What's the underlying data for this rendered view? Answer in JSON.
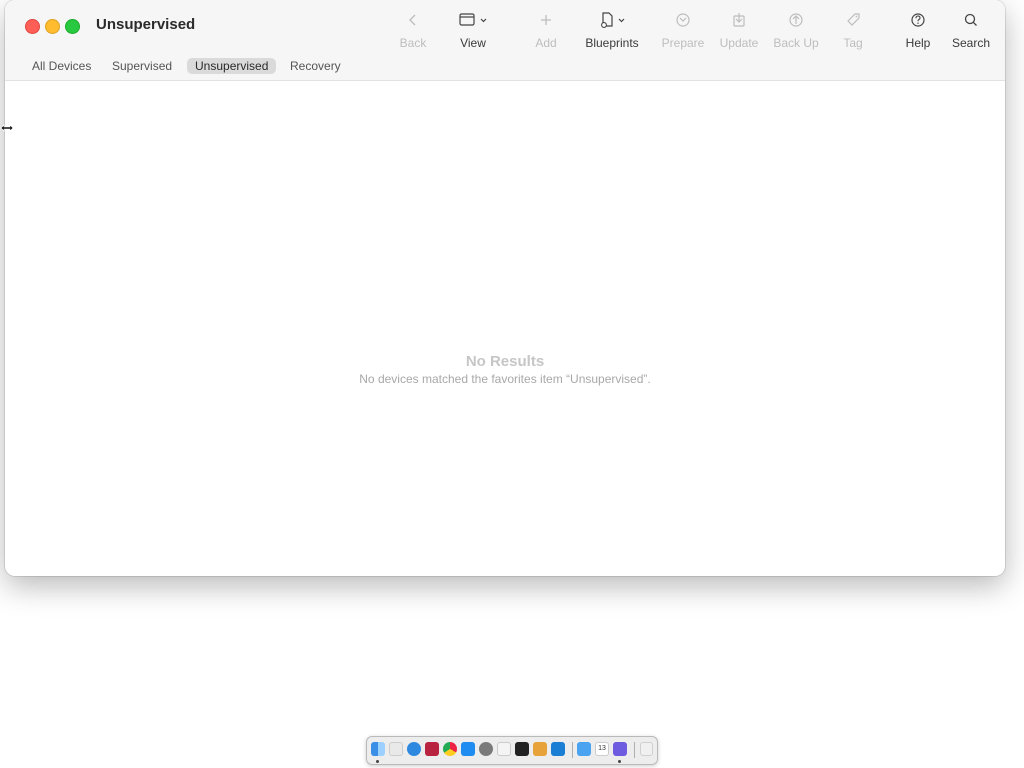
{
  "window": {
    "title": "Unsupervised"
  },
  "toolbar": {
    "back": "Back",
    "view": "View",
    "add": "Add",
    "blueprints": "Blueprints",
    "prepare": "Prepare",
    "update": "Update",
    "back_up": "Back Up",
    "tag": "Tag",
    "help": "Help",
    "search": "Search"
  },
  "tabs": [
    "All Devices",
    "Supervised",
    "Unsupervised",
    "Recovery"
  ],
  "selected_tab": "Unsupervised",
  "empty_state": {
    "title": "No Results",
    "message": "No devices matched the favorites item “Unsupervised”."
  },
  "dock": {
    "icons": [
      "finder-icon",
      "launchpad-icon",
      "safari-icon",
      "photo-booth-icon",
      "chrome-icon",
      "app-store-icon",
      "system-settings-icon",
      "notes-icon",
      "terminal-icon",
      "apple-configurator-icon",
      "vscode-icon",
      "downloads-icon",
      "calendar-icon",
      "apple-configurator-window-icon",
      "trash-icon"
    ],
    "calendar_day": "13"
  }
}
